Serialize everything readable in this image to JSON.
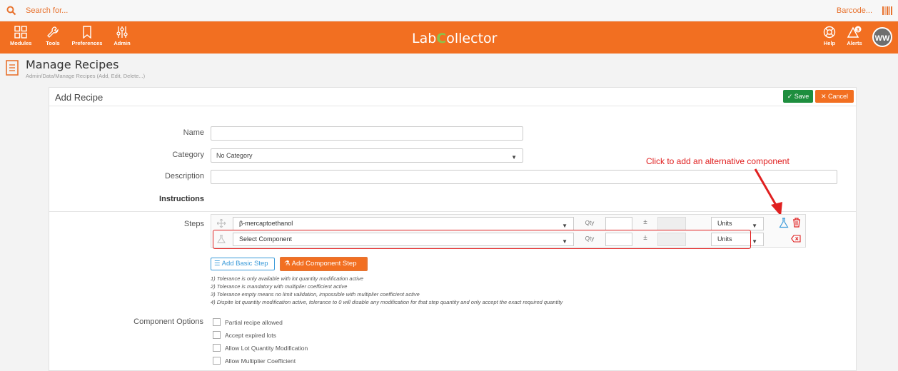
{
  "search": {
    "placeholder": "Search for...",
    "barcode_label": "Barcode..."
  },
  "nav": {
    "items": [
      {
        "label": "Modules",
        "icon": "grid-icon"
      },
      {
        "label": "Tools",
        "icon": "wrench-icon"
      },
      {
        "label": "Preferences",
        "icon": "bookmark-icon"
      },
      {
        "label": "Admin",
        "icon": "sliders-icon"
      }
    ],
    "logo_pre": "Lab",
    "logo_c": "C",
    "logo_post": "ollector",
    "right": [
      {
        "label": "Help",
        "icon": "lifebuoy-icon"
      },
      {
        "label": "Alerts",
        "icon": "bell-alert-icon"
      }
    ],
    "avatar": "WW"
  },
  "page": {
    "title": "Manage Recipes",
    "breadcrumb": "Admin/Data/Manage Recipes (Add, Edit, Delete...)"
  },
  "card": {
    "title": "Add Recipe",
    "save_label": "✓ Save",
    "cancel_label": "✕ Cancel"
  },
  "form": {
    "name_label": "Name",
    "name_value": "",
    "category_label": "Category",
    "category_value": "No Category",
    "description_label": "Description",
    "description_value": "",
    "instructions_label": "Instructions",
    "steps_label": "Steps"
  },
  "annotation": "Click to add an alternative component",
  "steps": [
    {
      "component": "β-mercaptoethanol",
      "qty_label": "Qty",
      "pm": "±",
      "units": "Units"
    },
    {
      "component": "Select Component",
      "qty_label": "Qty",
      "pm": "±",
      "units": "Units"
    }
  ],
  "buttons": {
    "add_basic": "☰ Add Basic Step",
    "add_component": "⚗ Add Component Step"
  },
  "notes": [
    "1) Tolerance is only available with lot quantity modification active",
    "2) Tolerance is mandatory with multiplier coefficient active",
    "3) Tolerance empty means no limit validation, impossible with multiplier coefficient active",
    "4) Dispite lot quantity modification active, tolerance to 0 will disable any modification for that step quantity and only accept the exact required quantity"
  ],
  "component_options": {
    "label": "Component Options",
    "options": [
      {
        "label": "Partial recipe allowed",
        "checked": false
      },
      {
        "label": "Accept expired lots",
        "checked": false
      },
      {
        "label": "Allow Lot Quantity Modification",
        "checked": false
      },
      {
        "label": "Allow Multiplier Coefficient",
        "checked": false
      }
    ]
  },
  "colors": {
    "brand": "#f26f21",
    "save": "#1e8e3e",
    "alert": "#e02020",
    "logo_accent": "#8bc34a"
  }
}
